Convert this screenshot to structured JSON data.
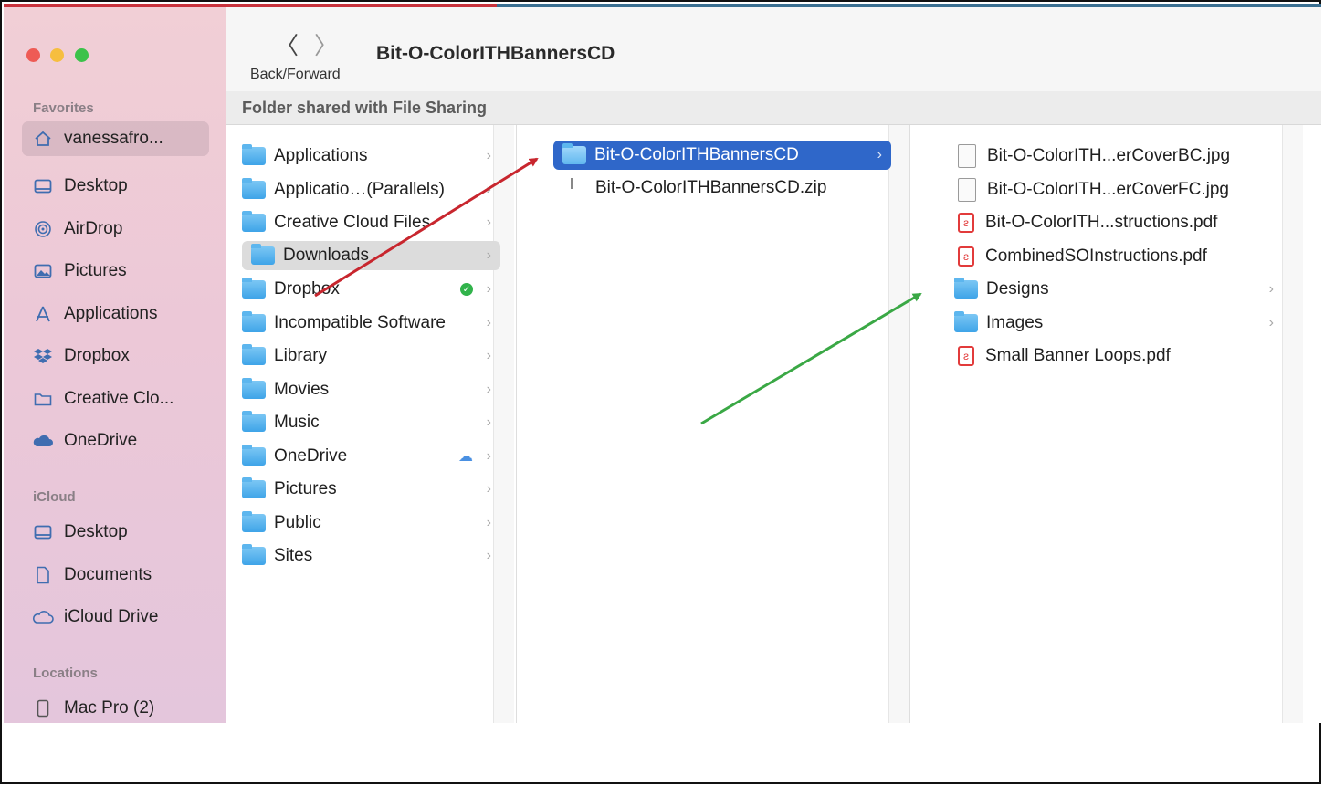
{
  "toolbar": {
    "back_glyph": "〈",
    "forward_glyph": "〉",
    "nav_label": "Back/Forward",
    "title": "Bit-O-ColorITHBannersCD"
  },
  "infobar": {
    "text": "Folder shared with File Sharing"
  },
  "sidebar": {
    "favorites_heading": "Favorites",
    "favorites": [
      {
        "label": "vanessafro...",
        "icon": "home-icon"
      },
      {
        "label": "Desktop",
        "icon": "desktop-icon"
      },
      {
        "label": "AirDrop",
        "icon": "airdrop-icon"
      },
      {
        "label": "Pictures",
        "icon": "pictures-icon"
      },
      {
        "label": "Applications",
        "icon": "applications-icon"
      },
      {
        "label": "Dropbox",
        "icon": "dropbox-icon"
      },
      {
        "label": "Creative Clo...",
        "icon": "folder-icon"
      },
      {
        "label": "OneDrive",
        "icon": "cloud-icon"
      }
    ],
    "icloud_heading": "iCloud",
    "icloud": [
      {
        "label": "Desktop",
        "icon": "desktop-icon"
      },
      {
        "label": "Documents",
        "icon": "document-icon"
      },
      {
        "label": "iCloud Drive",
        "icon": "cloud-icon"
      }
    ],
    "locations_heading": "Locations",
    "locations": [
      {
        "label": "Mac Pro (2)",
        "icon": "computer-icon"
      }
    ]
  },
  "column1": [
    "Applications",
    "Applicatio…(Parallels)",
    "Creative Cloud Files",
    "Downloads",
    "Dropbox",
    "Incompatible Software",
    "Library",
    "Movies",
    "Music",
    "OneDrive",
    "Pictures",
    "Public",
    "Sites"
  ],
  "column2": [
    "Bit-O-ColorITHBannersCD",
    "Bit-O-ColorITHBannersCD.zip"
  ],
  "column3": [
    "Bit-O-ColorITH...erCoverBC.jpg",
    "Bit-O-ColorITH...erCoverFC.jpg",
    "Bit-O-ColorITH...structions.pdf",
    "CombinedSOInstructions.pdf",
    "Designs",
    "Images",
    "Small Banner Loops.pdf"
  ],
  "colors": {
    "selection_blue": "#2f67c9",
    "arrow_red": "#c8262e",
    "arrow_green": "#3aa845"
  }
}
